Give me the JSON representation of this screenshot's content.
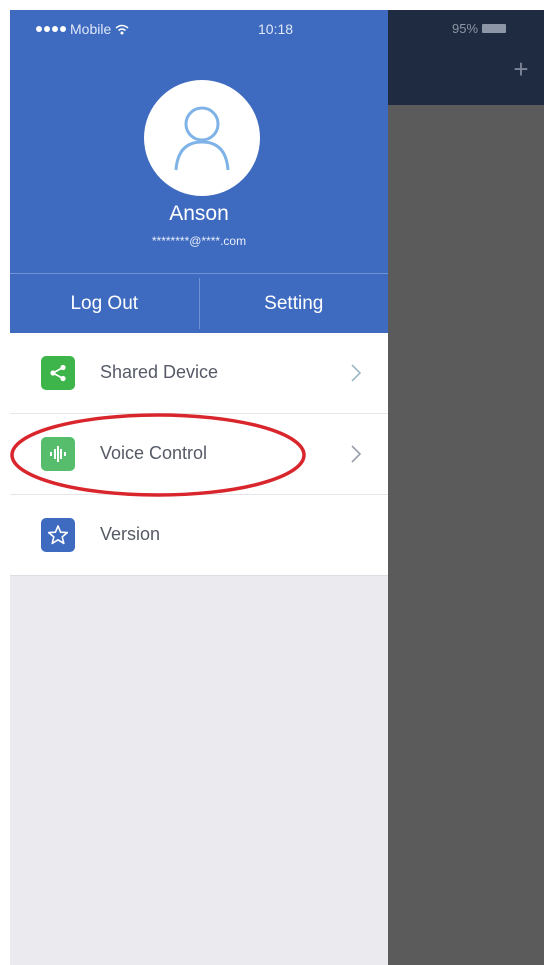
{
  "status_bar": {
    "carrier": "Mobile",
    "time": "10:18",
    "battery": "95%"
  },
  "profile": {
    "name": "Anson",
    "email": "********@****.com"
  },
  "actions": {
    "logout_label": "Log Out",
    "setting_label": "Setting"
  },
  "menu": {
    "items": [
      {
        "label": "Shared Device",
        "icon": "share-icon",
        "icon_color": "#3db54a",
        "has_chevron": true
      },
      {
        "label": "Voice Control",
        "icon": "voice-wave-icon",
        "icon_color": "#55bd6b",
        "has_chevron": true
      },
      {
        "label": "Version",
        "icon": "star-icon",
        "icon_color": "#3e6bc0",
        "has_chevron": false
      }
    ]
  },
  "main": {
    "add_label": "+"
  },
  "colors": {
    "header_blue": "#3e6bc0",
    "drawer_bg": "#ebebef",
    "main_overlay": "#5b5b5b",
    "main_topbar": "#1f2b40",
    "highlight_red": "#d9262c"
  }
}
